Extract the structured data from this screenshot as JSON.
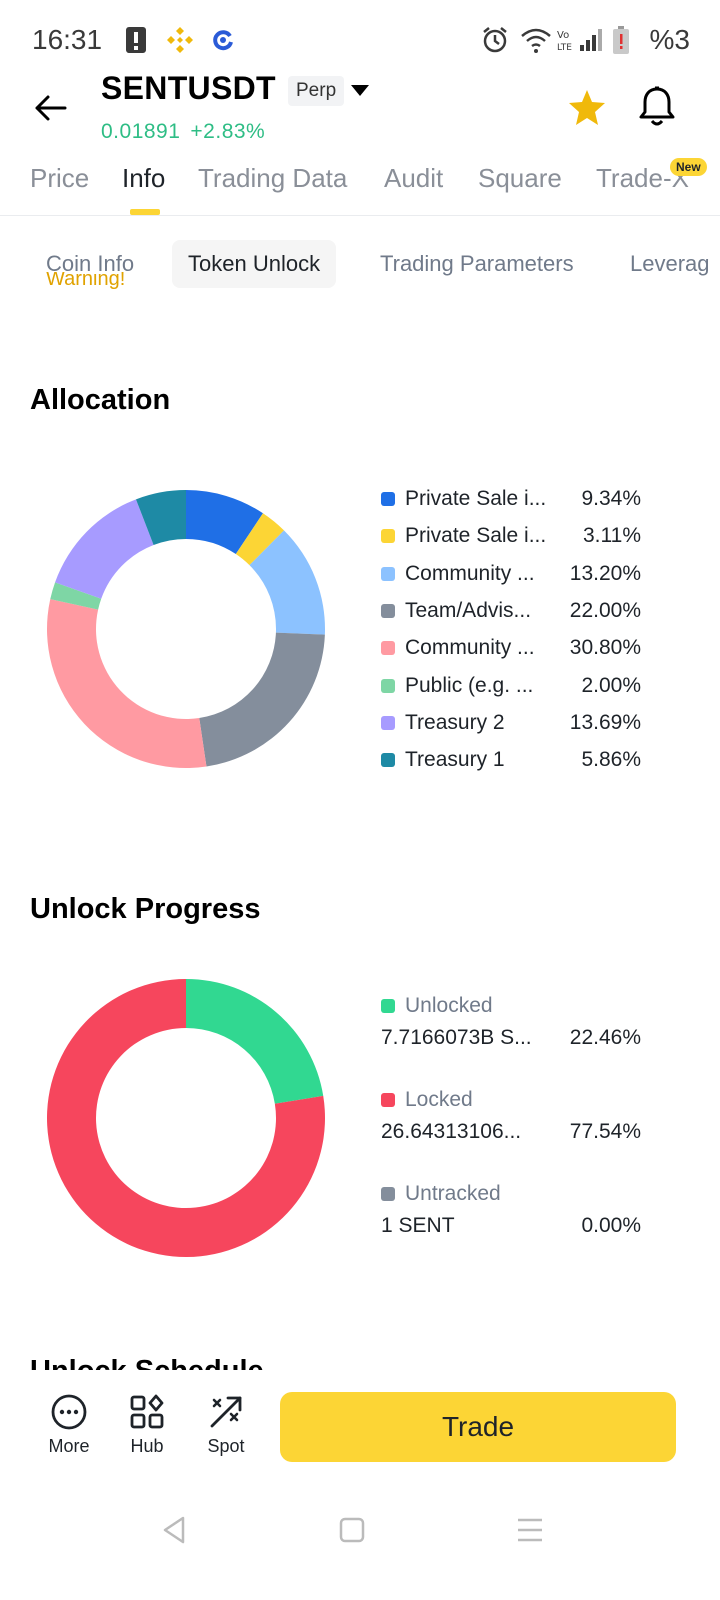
{
  "status_bar": {
    "time": "16:31",
    "battery_text": "%3"
  },
  "header": {
    "symbol": "SENTUSDT",
    "badge": "Perp",
    "price": "0.01891",
    "change": "+2.83%",
    "price_color": "#2ebd85"
  },
  "main_tabs": [
    {
      "label": "Price",
      "active": false
    },
    {
      "label": "Info",
      "active": true
    },
    {
      "label": "Trading Data",
      "active": false
    },
    {
      "label": "Audit",
      "active": false
    },
    {
      "label": "Square",
      "active": false
    },
    {
      "label": "Trade-X",
      "active": false,
      "badge": "New"
    }
  ],
  "sub_tabs": [
    {
      "label": "Coin Info",
      "active": false
    },
    {
      "label": "Token Unlock",
      "active": true
    },
    {
      "label": "Trading Parameters",
      "active": false
    },
    {
      "label": "Leverag",
      "active": false
    }
  ],
  "warning_peek": "Warning!",
  "allocation": {
    "title": "Allocation",
    "chart_data": {
      "type": "pie",
      "donut": true,
      "start_angle_deg": 0,
      "slices": [
        {
          "label": "Private Sale i...",
          "value": 9.34,
          "display": "9.34%",
          "color": "#1f6fe6"
        },
        {
          "label": "Private Sale i...",
          "value": 3.11,
          "display": "3.11%",
          "color": "#fcd535"
        },
        {
          "label": "Community ...",
          "value": 13.2,
          "display": "13.20%",
          "color": "#8cc2ff"
        },
        {
          "label": "Team/Advis...",
          "value": 22.0,
          "display": "22.00%",
          "color": "#848e9c"
        },
        {
          "label": "Community ...",
          "value": 30.8,
          "display": "30.80%",
          "color": "#ff9aa2"
        },
        {
          "label": "Public (e.g. ...",
          "value": 2.0,
          "display": "2.00%",
          "color": "#7ed6a5"
        },
        {
          "label": "Treasury 2",
          "value": 13.69,
          "display": "13.69%",
          "color": "#a79bff"
        },
        {
          "label": "Treasury 1",
          "value": 5.86,
          "display": "5.86%",
          "color": "#1e8aa5"
        }
      ]
    }
  },
  "unlock_progress": {
    "title": "Unlock Progress",
    "chart_data": {
      "type": "pie",
      "donut": true,
      "start_angle_deg": 0,
      "slices": [
        {
          "label": "Unlocked",
          "amount": "7.7166073B S...",
          "value": 22.46,
          "display": "22.46%",
          "color": "#31d891"
        },
        {
          "label": "Locked",
          "amount": "26.64313106...",
          "value": 77.54,
          "display": "77.54%",
          "color": "#f6465d"
        },
        {
          "label": "Untracked",
          "amount": "1 SENT",
          "value": 0.0,
          "display": "0.00%",
          "color": "#848e9c"
        }
      ]
    }
  },
  "schedule_peek": "Unlock Schedule",
  "bottom_bar": {
    "more": "More",
    "hub": "Hub",
    "spot": "Spot",
    "trade": "Trade",
    "trade_color": "#fcd535"
  }
}
